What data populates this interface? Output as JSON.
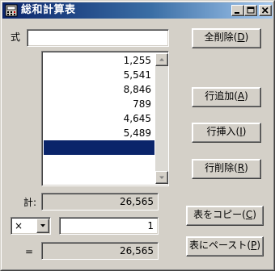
{
  "window": {
    "title": "総和計算表",
    "icon": "calculator-table-icon"
  },
  "formula": {
    "label": "式",
    "value": ""
  },
  "list": {
    "items": [
      "1,255",
      "5,541",
      "8,846",
      "789",
      "4,645",
      "5,489",
      "",
      "",
      ""
    ],
    "selected_index": 6
  },
  "total": {
    "label": "計:",
    "value": "26,565"
  },
  "operator": {
    "selected": "×",
    "operand": "1"
  },
  "result": {
    "label": "=",
    "value": "26,565"
  },
  "buttons": {
    "clear_all": {
      "text": "全削除",
      "key": "D"
    },
    "add_row": {
      "text": "行追加",
      "key": "A"
    },
    "insert_row": {
      "text": "行挿入",
      "key": "I"
    },
    "delete_row": {
      "text": "行削除",
      "key": "R"
    },
    "copy_table": {
      "text": "表をコピー",
      "key": "C"
    },
    "paste_table": {
      "text": "表にペースト",
      "key": "P"
    }
  },
  "colors": {
    "title_start": "#0a246a",
    "title_end": "#a6caf0",
    "selection": "#0a246a",
    "face": "#d4d0c8"
  }
}
